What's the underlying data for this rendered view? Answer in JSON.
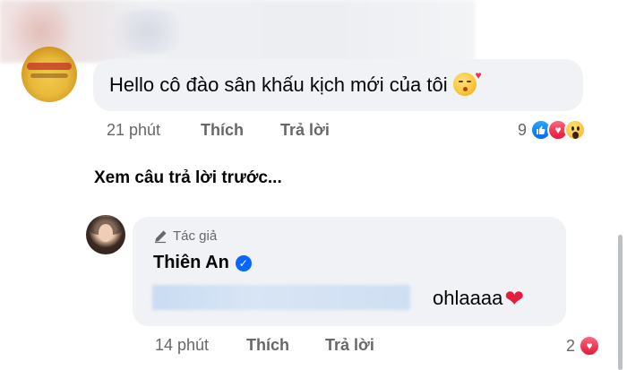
{
  "comment1": {
    "text": "Hello cô đào sân khấu kịch mới của tôi",
    "emoji": "kissing-face-heart-icon",
    "time": "21 phút",
    "like_label": "Thích",
    "reply_label": "Trả lời",
    "reaction_count": "9",
    "reactions": [
      "like-reaction-icon",
      "love-reaction-icon",
      "wow-reaction-icon"
    ]
  },
  "view_previous_replies": "Xem câu trả lời trước...",
  "reply": {
    "author_badge": "Tác giả",
    "author_name": "Thiên An",
    "verified_icon": "verified-badge-icon",
    "text": "ohlaaaa",
    "emoji": "red-heart-icon",
    "time": "14 phút",
    "like_label": "Thích",
    "reply_label": "Trả lời",
    "reaction_count": "2",
    "reactions": [
      "love-reaction-icon"
    ]
  },
  "colors": {
    "bubble_bg": "#f0f2f5",
    "meta_text": "#65676b",
    "accent_blue": "#0866ff",
    "love_red": "#e41e3f"
  }
}
